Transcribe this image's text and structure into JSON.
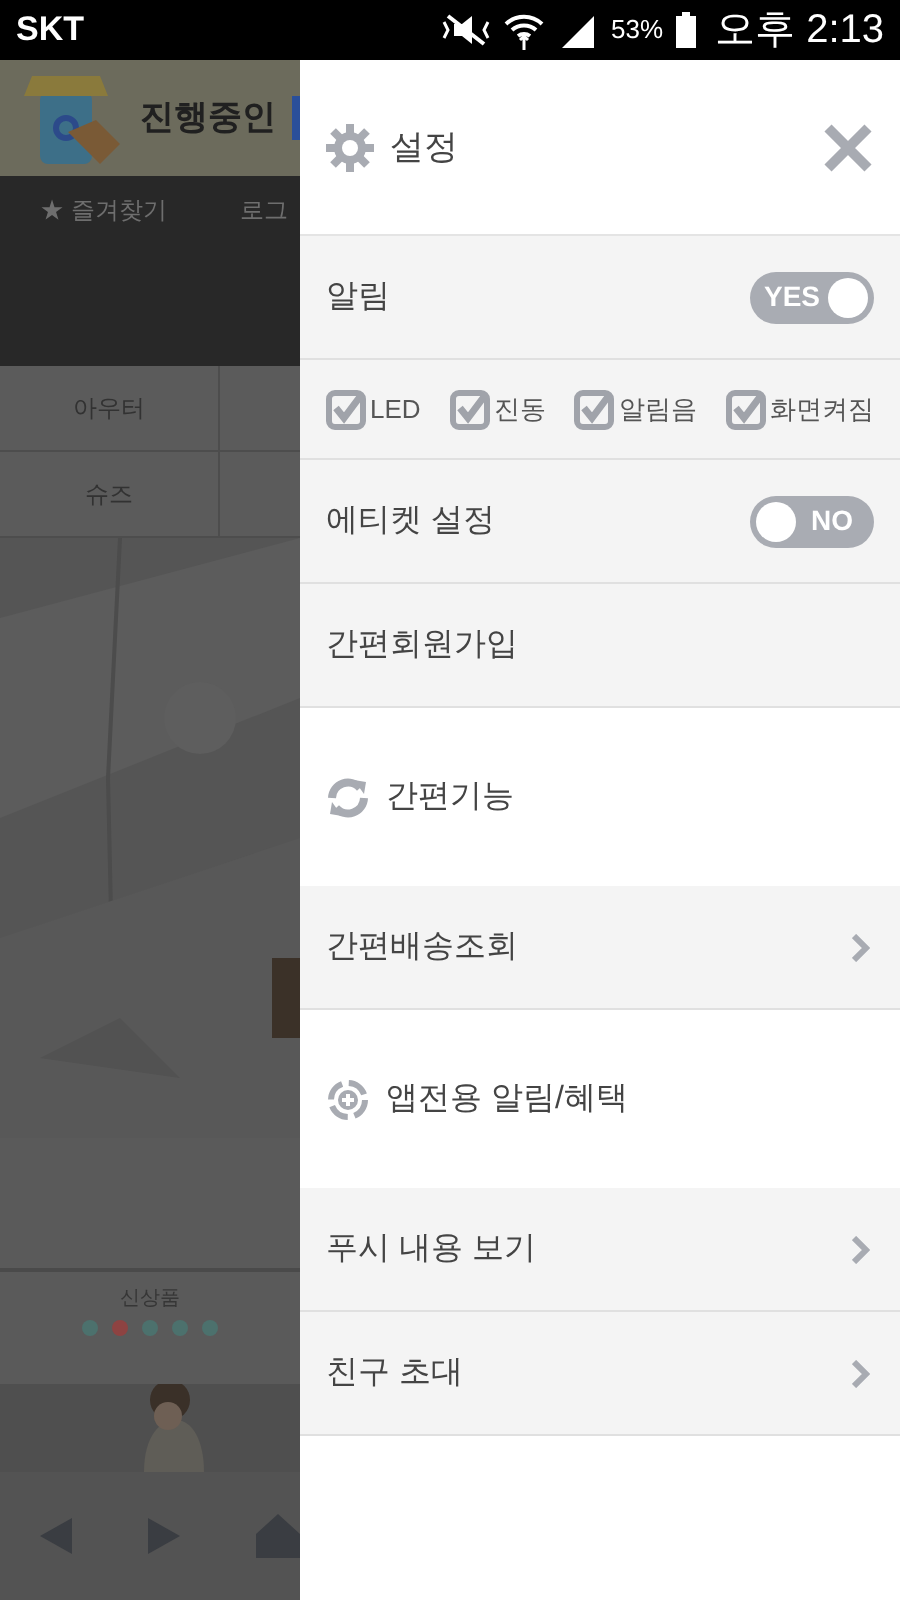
{
  "status_bar": {
    "carrier": "SKT",
    "battery": "53%",
    "time": "오후 2:13"
  },
  "background_page": {
    "logo_text": "진행중인",
    "nav": [
      "★ 즐겨찾기",
      "로그"
    ],
    "categories": [
      "아우터",
      "슈즈"
    ],
    "section_title": "신상품",
    "dots": [
      {
        "selected": false
      },
      {
        "selected": true
      },
      {
        "selected": false
      },
      {
        "selected": false
      },
      {
        "selected": false
      }
    ]
  },
  "drawer": {
    "title": "설정",
    "rows": [
      {
        "kind": "toggle",
        "label": "알림",
        "on": true,
        "toggle_label": "YES"
      },
      {
        "kind": "checks",
        "items": [
          {
            "label": "LED",
            "checked": true
          },
          {
            "label": "진동",
            "checked": true
          },
          {
            "label": "알림음",
            "checked": true
          },
          {
            "label": "화면켜짐",
            "checked": true
          }
        ]
      },
      {
        "kind": "toggle",
        "label": "에티켓 설정",
        "on": false,
        "toggle_label": "NO"
      },
      {
        "kind": "link",
        "label": "간편회원가입"
      },
      {
        "kind": "refresh-header",
        "label": "간편기능"
      },
      {
        "kind": "chevron-link",
        "label": "간편배송조회"
      },
      {
        "kind": "target-header",
        "label": "앱전용 알림/혜택"
      },
      {
        "kind": "chevron-link",
        "label": "푸시 내용 보기"
      },
      {
        "kind": "chevron-link",
        "label": "친구 초대"
      }
    ]
  }
}
